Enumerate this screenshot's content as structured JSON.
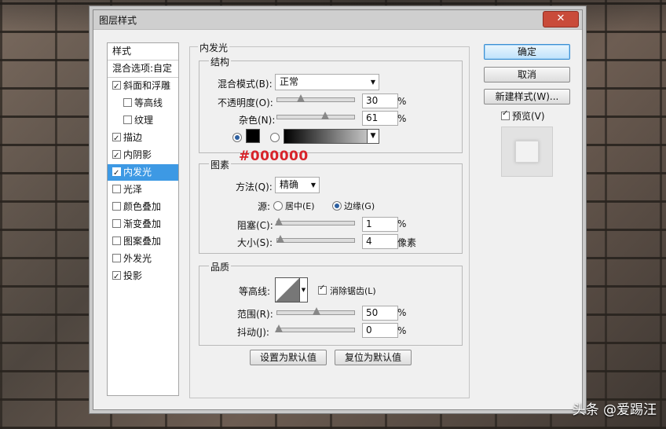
{
  "dialog": {
    "title": "图层样式",
    "close_glyph": "✕"
  },
  "styles_panel": {
    "header": "样式",
    "blend_options": "混合选项:自定",
    "items": [
      {
        "label": "斜面和浮雕",
        "checked": true,
        "indent": false,
        "selected": false
      },
      {
        "label": "等高线",
        "checked": false,
        "indent": true,
        "selected": false
      },
      {
        "label": "纹理",
        "checked": false,
        "indent": true,
        "selected": false
      },
      {
        "label": "描边",
        "checked": true,
        "indent": false,
        "selected": false
      },
      {
        "label": "内阴影",
        "checked": true,
        "indent": false,
        "selected": false
      },
      {
        "label": "内发光",
        "checked": true,
        "indent": false,
        "selected": true
      },
      {
        "label": "光泽",
        "checked": false,
        "indent": false,
        "selected": false
      },
      {
        "label": "颜色叠加",
        "checked": false,
        "indent": false,
        "selected": false
      },
      {
        "label": "渐变叠加",
        "checked": false,
        "indent": false,
        "selected": false
      },
      {
        "label": "图案叠加",
        "checked": false,
        "indent": false,
        "selected": false
      },
      {
        "label": "外发光",
        "checked": false,
        "indent": false,
        "selected": false
      },
      {
        "label": "投影",
        "checked": true,
        "indent": false,
        "selected": false
      }
    ]
  },
  "main": {
    "title": "内发光",
    "structure": {
      "title": "结构",
      "blend_mode_label": "混合模式(B):",
      "blend_mode_value": "正常",
      "opacity_label": "不透明度(O):",
      "opacity_value": "30",
      "opacity_unit": "%",
      "noise_label": "杂色(N):",
      "noise_value": "61",
      "noise_unit": "%",
      "color_swatch": "#000000"
    },
    "annotation": "#000000",
    "elements": {
      "title": "图素",
      "method_label": "方法(Q):",
      "method_value": "精确",
      "source_label": "源:",
      "source_center": "居中(E)",
      "source_edge": "边缘(G)",
      "choke_label": "阻塞(C):",
      "choke_value": "1",
      "choke_unit": "%",
      "size_label": "大小(S):",
      "size_value": "4",
      "size_unit": "像素"
    },
    "quality": {
      "title": "品质",
      "contour_label": "等高线:",
      "antialias_label": "消除锯齿(L)",
      "range_label": "范围(R):",
      "range_value": "50",
      "range_unit": "%",
      "jitter_label": "抖动(J):",
      "jitter_value": "0",
      "jitter_unit": "%"
    },
    "set_default": "设置为默认值",
    "reset_default": "复位为默认值"
  },
  "buttons": {
    "ok": "确定",
    "cancel": "取消",
    "new_style": "新建样式(W)...",
    "preview": "预览(V)"
  },
  "watermark": "头条 @爱踢汪"
}
